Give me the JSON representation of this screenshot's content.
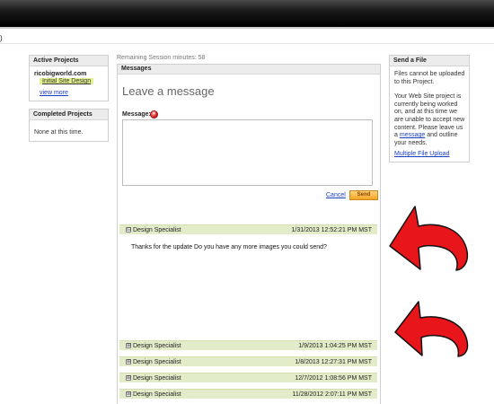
{
  "header": {
    "corner_text": ")"
  },
  "active_projects": {
    "title": "Active Projects",
    "site": "ricobigworld.com",
    "project": "Initial Site Design",
    "view_more": "view more"
  },
  "completed_projects": {
    "title": "Completed Projects",
    "none_text": "None at this time."
  },
  "session": {
    "text": "Remaining Session minutes: 58"
  },
  "messages": {
    "title": "Messages",
    "heading": "Leave a message",
    "field_label": "Message:",
    "textarea_value": "",
    "cancel_label": "Cancel",
    "send_label": "Send",
    "threads": [
      {
        "toggle": "⊟",
        "sender": "Design Specialist",
        "timestamp": "1/31/2013 12:52:21 PM MST",
        "body": "Thanks for the update Do you have any more images you could send?"
      },
      {
        "toggle": "⊞",
        "sender": "Design Specialist",
        "timestamp": "1/9/2013 1:04:25 PM MST"
      },
      {
        "toggle": "⊞",
        "sender": "Design Specialist",
        "timestamp": "1/8/2013 12:27:31 PM MST"
      },
      {
        "toggle": "⊞",
        "sender": "Design Specialist",
        "timestamp": "12/7/2012 1:08:56 PM MST"
      },
      {
        "toggle": "⊞",
        "sender": "Design Specialist",
        "timestamp": "11/28/2012 2:07:11 PM MST"
      }
    ]
  },
  "send_file": {
    "title": "Send a File",
    "text_1": "Files cannot be uploaded to this Project.",
    "text_2_before": "Your Web Site project is currently being worked on, and at this time we are unable to accept new content. Please leave us a",
    "text_2_link": "message",
    "text_2_after": "and outline your needs.",
    "upload_link": "Multiple File Upload"
  },
  "colors": {
    "accent_link": "#1a3fc4",
    "thread_bg": "#e3ecc8",
    "send_button": "#f6a623",
    "highlight": "#e3f28c",
    "arrow": "#e8151b"
  },
  "icons": {
    "error": "error-x-icon",
    "expand": "plus-box-icon",
    "collapse": "minus-box-icon",
    "annotation": "curved-arrow-icon"
  }
}
